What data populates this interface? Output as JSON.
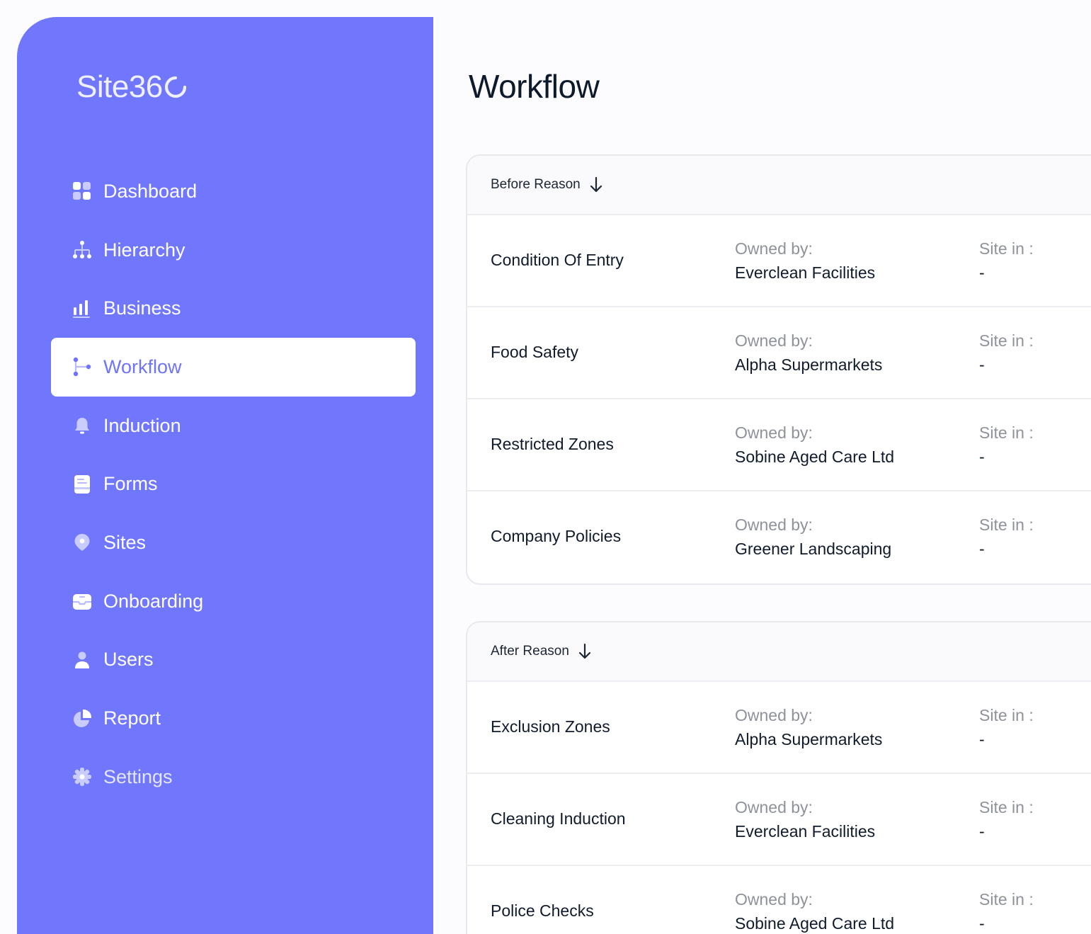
{
  "brand": {
    "logo_text": "Site36"
  },
  "colors": {
    "sidebar": "#7177fd",
    "active_text": "#6e74fb",
    "text_primary": "#111b2b",
    "text_muted": "#8e929a"
  },
  "sidebar": {
    "items": [
      {
        "label": "Dashboard",
        "icon": "dashboard-icon"
      },
      {
        "label": "Hierarchy",
        "icon": "hierarchy-icon"
      },
      {
        "label": "Business",
        "icon": "bar-chart-icon"
      },
      {
        "label": "Workflow",
        "icon": "workflow-icon",
        "active": true
      },
      {
        "label": "Induction",
        "icon": "bell-icon"
      },
      {
        "label": "Forms",
        "icon": "form-icon"
      },
      {
        "label": "Sites",
        "icon": "map-pin-icon"
      },
      {
        "label": "Onboarding",
        "icon": "inbox-icon"
      },
      {
        "label": "Users",
        "icon": "user-icon"
      },
      {
        "label": "Report",
        "icon": "pie-chart-icon"
      },
      {
        "label": "Settings",
        "icon": "gear-icon"
      }
    ]
  },
  "main": {
    "title": "Workflow",
    "groups": [
      {
        "header": "Before Reason",
        "rows": [
          {
            "name": "Condition Of Entry",
            "owner_label": "Owned by:",
            "owner": "Everclean Facilities",
            "site_label": "Site in :",
            "site": "-"
          },
          {
            "name": "Food Safety",
            "owner_label": "Owned by:",
            "owner": "Alpha Supermarkets",
            "site_label": "Site in :",
            "site": "-"
          },
          {
            "name": "Restricted Zones",
            "owner_label": "Owned by:",
            "owner": "Sobine Aged Care Ltd",
            "site_label": "Site in :",
            "site": "-"
          },
          {
            "name": "Company Policies",
            "owner_label": "Owned by:",
            "owner": "Greener Landscaping",
            "site_label": "Site in :",
            "site": "-"
          }
        ]
      },
      {
        "header": "After Reason",
        "rows": [
          {
            "name": "Exclusion Zones",
            "owner_label": "Owned by:",
            "owner": "Alpha Supermarkets",
            "site_label": "Site in :",
            "site": "-"
          },
          {
            "name": "Cleaning Induction",
            "owner_label": "Owned by:",
            "owner": "Everclean Facilities",
            "site_label": "Site in :",
            "site": "-"
          },
          {
            "name": "Police Checks",
            "owner_label": "Owned by:",
            "owner": "Sobine Aged Care Ltd",
            "site_label": "Site in :",
            "site": "-"
          }
        ]
      }
    ]
  }
}
